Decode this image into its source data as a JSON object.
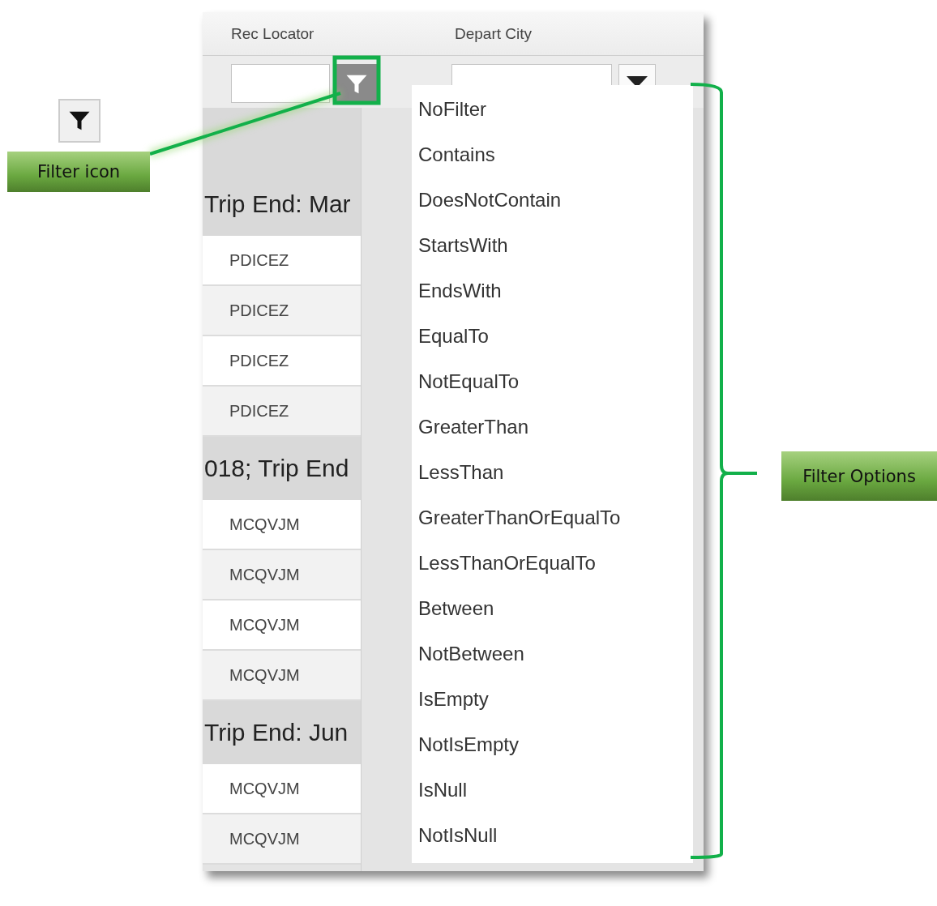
{
  "columns": [
    {
      "label": "Rec Locator"
    },
    {
      "label": "Depart City"
    }
  ],
  "groups": [
    {
      "header": "Trip End: Mar",
      "rows": [
        "PDICEZ",
        "PDICEZ",
        "PDICEZ",
        "PDICEZ"
      ]
    },
    {
      "header": "018; Trip End",
      "rows": [
        "MCQVJM",
        "MCQVJM",
        "MCQVJM",
        "MCQVJM"
      ]
    },
    {
      "header": "Trip End: Jun",
      "rows": [
        "MCQVJM",
        "MCQVJM"
      ]
    }
  ],
  "filter_menu": {
    "options": [
      "NoFilter",
      "Contains",
      "DoesNotContain",
      "StartsWith",
      "EndsWith",
      "EqualTo",
      "NotEqualTo",
      "GreaterThan",
      "LessThan",
      "GreaterThanOrEqualTo",
      "LessThanOrEqualTo",
      "Between",
      "NotBetween",
      "IsEmpty",
      "NotIsEmpty",
      "IsNull",
      "NotIsNull"
    ]
  },
  "annotations": [
    {
      "kind": "icon",
      "label": "Filter icon"
    },
    {
      "kind": "brace",
      "label": "Filter Options"
    }
  ]
}
